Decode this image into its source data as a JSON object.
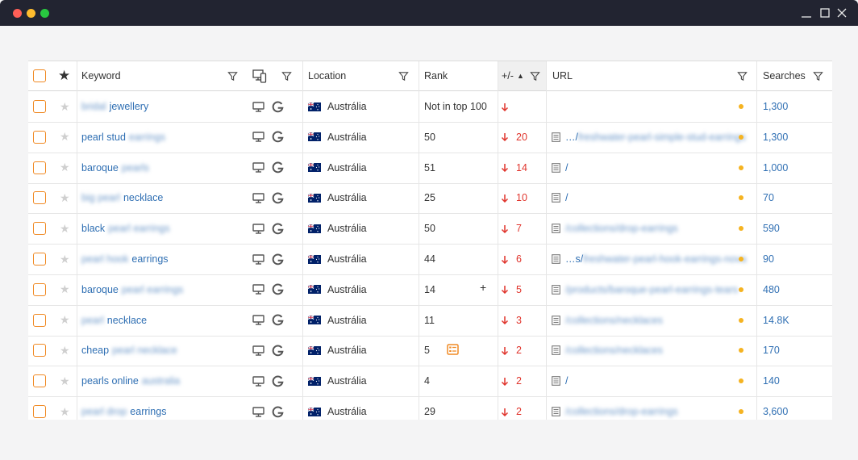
{
  "window": {
    "controls": [
      "minimize-icon",
      "maximize-icon",
      "close-icon"
    ]
  },
  "table": {
    "columns": {
      "keyword": "Keyword",
      "location": "Location",
      "rank": "Rank",
      "change": "+/-",
      "url": "URL",
      "searches": "Searches"
    },
    "rows": [
      {
        "kw_pre": "bridal",
        "kw": "jewellery",
        "kw_post": "",
        "location": "Austrália",
        "rank": "Not in top 100",
        "change": "",
        "url_plain": "",
        "url_blur": "",
        "searches": "1,300"
      },
      {
        "kw_pre": "",
        "kw": "pearl stud",
        "kw_post": "earrings",
        "location": "Austrália",
        "rank": "50",
        "change": "20",
        "url_plain": "…/",
        "url_blur": "freshwater-pearl-simple-stud-earrings",
        "searches": "1,300"
      },
      {
        "kw_pre": "",
        "kw": "baroque",
        "kw_post": "pearls",
        "location": "Austrália",
        "rank": "51",
        "change": "14",
        "url_plain": "/",
        "url_blur": "",
        "searches": "1,000"
      },
      {
        "kw_pre": "big pearl",
        "kw": "necklace",
        "kw_post": "",
        "location": "Austrália",
        "rank": "25",
        "change": "10",
        "url_plain": "/",
        "url_blur": "",
        "searches": "70"
      },
      {
        "kw_pre": "",
        "kw": "black",
        "kw_post": "pearl earrings",
        "location": "Austrália",
        "rank": "50",
        "change": "7",
        "url_plain": "",
        "url_blur": "/collections/drop-earrings",
        "searches": "590"
      },
      {
        "kw_pre": "pearl hook",
        "kw": "earrings",
        "kw_post": "",
        "location": "Austrália",
        "rank": "44",
        "change": "6",
        "url_plain": "…s/",
        "url_blur": "freshwater-pearl-hook-earrings-nova",
        "searches": "90"
      },
      {
        "kw_pre": "",
        "kw": "baroque",
        "kw_post": "pearl earrings",
        "location": "Austrália",
        "rank": "14",
        "change": "5",
        "url_plain": "",
        "url_blur": "/products/baroque-pearl-earrings-tears",
        "searches": "480"
      },
      {
        "kw_pre": "pearl",
        "kw": "necklace",
        "kw_post": "",
        "location": "Austrália",
        "rank": "11",
        "change": "3",
        "url_plain": "",
        "url_blur": "/collections/necklaces",
        "searches": "14.8K"
      },
      {
        "kw_pre": "",
        "kw": "cheap",
        "kw_post": "pearl necklace",
        "location": "Austrália",
        "rank": "5",
        "change": "2",
        "url_plain": "",
        "url_blur": "/collections/necklaces",
        "searches": "170"
      },
      {
        "kw_pre": "",
        "kw": "pearls online",
        "kw_post": "australia",
        "location": "Austrália",
        "rank": "4",
        "change": "2",
        "url_plain": "/",
        "url_blur": "",
        "searches": "140"
      },
      {
        "kw_pre": "pearl drop",
        "kw": "earrings",
        "kw_post": "",
        "location": "Austrália",
        "rank": "29",
        "change": "2",
        "url_plain": "",
        "url_blur": "/collections/drop-earrings",
        "searches": "3,600"
      }
    ],
    "extras": {
      "row6_plus": "+"
    }
  },
  "colors": {
    "accent_orange": "#f08a24",
    "link_blue": "#2f6fb3",
    "decline_red": "#e0342c",
    "status_dot": "#f5b321",
    "titlebar": "#222431"
  }
}
